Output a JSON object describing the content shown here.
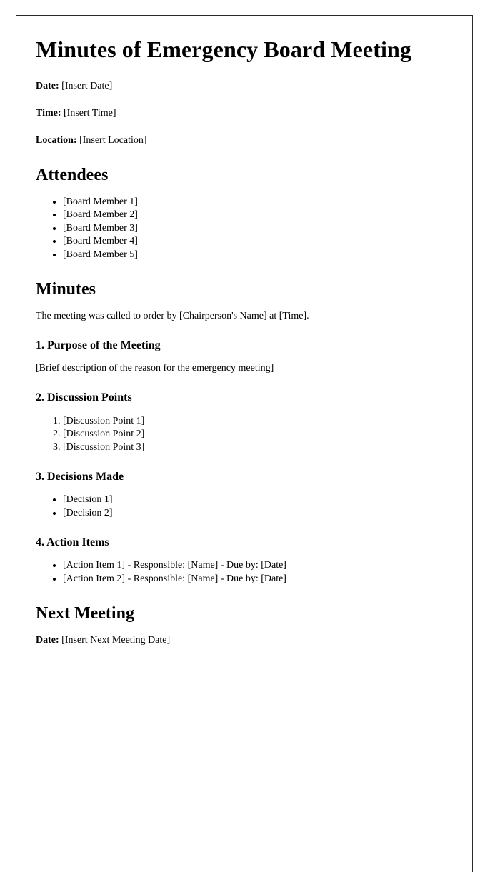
{
  "document": {
    "title": "Minutes of Emergency Board Meeting",
    "meta": [
      {
        "label": "Date:",
        "value": "[Insert Date]"
      },
      {
        "label": "Time:",
        "value": "[Insert Time]"
      },
      {
        "label": "Location:",
        "value": "[Insert Location]"
      }
    ],
    "attendees": {
      "heading": "Attendees",
      "items": [
        "[Board Member 1]",
        "[Board Member 2]",
        "[Board Member 3]",
        "[Board Member 4]",
        "[Board Member 5]"
      ]
    },
    "minutes": {
      "heading": "Minutes",
      "intro": "The meeting was called to order by [Chairperson's Name] at [Time].",
      "sections": [
        {
          "heading": "1. Purpose of the Meeting",
          "paragraph": "[Brief description of the reason for the emergency meeting]"
        },
        {
          "heading": "2. Discussion Points",
          "items": [
            "[Discussion Point 1]",
            "[Discussion Point 2]",
            "[Discussion Point 3]"
          ]
        },
        {
          "heading": "3. Decisions Made",
          "items": [
            "[Decision 1]",
            "[Decision 2]"
          ]
        },
        {
          "heading": "4. Action Items",
          "items": [
            "[Action Item 1] - Responsible: [Name] - Due by: [Date]",
            "[Action Item 2] - Responsible: [Name] - Due by: [Date]"
          ]
        }
      ]
    },
    "next_meeting": {
      "heading": "Next Meeting",
      "meta": [
        {
          "label": "Date:",
          "value": "[Insert Next Meeting Date]"
        }
      ]
    }
  },
  "style": {
    "border_color": "#2b2b2b",
    "text_color": "#000000",
    "background": "#ffffff"
  }
}
